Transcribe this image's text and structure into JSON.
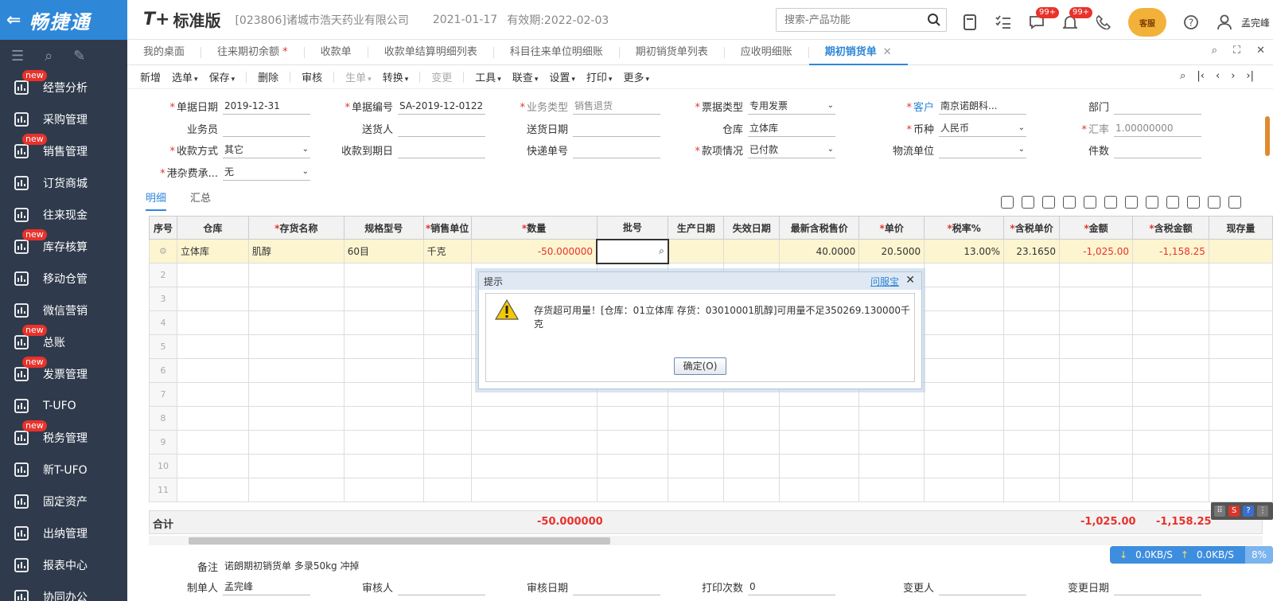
{
  "app": {
    "logo_text": "畅捷通",
    "brand": "T+",
    "brand_sub": "标准版",
    "company": "[023806]诸城市浩天药业有限公司",
    "date": "2021-01-17",
    "expiry": "有效期:2022-02-03",
    "search_placeholder": "搜索-产品功能",
    "badge1": "99+",
    "badge2": "99+",
    "kefu": "客服",
    "username": "孟完峰"
  },
  "sidebar": {
    "items": [
      {
        "label": "经营分析",
        "new": "new"
      },
      {
        "label": "采购管理",
        "new": ""
      },
      {
        "label": "销售管理",
        "new": "new"
      },
      {
        "label": "订货商城",
        "new": ""
      },
      {
        "label": "往来现金",
        "new": ""
      },
      {
        "label": "库存核算",
        "new": "new"
      },
      {
        "label": "移动仓管",
        "new": ""
      },
      {
        "label": "微信营销",
        "new": ""
      },
      {
        "label": "总账",
        "new": "new"
      },
      {
        "label": "发票管理",
        "new": "new"
      },
      {
        "label": "T-UFO",
        "new": ""
      },
      {
        "label": "税务管理",
        "new": "new"
      },
      {
        "label": "新T-UFO",
        "new": ""
      },
      {
        "label": "固定资产",
        "new": ""
      },
      {
        "label": "出纳管理",
        "new": ""
      },
      {
        "label": "报表中心",
        "new": ""
      },
      {
        "label": "协同办公",
        "new": ""
      }
    ]
  },
  "tabs": [
    {
      "label": "我的桌面",
      "star": ""
    },
    {
      "label": "往来期初余额",
      "star": "*"
    },
    {
      "label": "收款单",
      "star": ""
    },
    {
      "label": "收款单结算明细列表",
      "star": ""
    },
    {
      "label": "科目往来单位明细账",
      "star": ""
    },
    {
      "label": "期初销货单列表",
      "star": ""
    },
    {
      "label": "应收明细账",
      "star": ""
    },
    {
      "label": "期初销货单",
      "star": ""
    }
  ],
  "toolbar": {
    "new": "新增",
    "select": "选单",
    "save": "保存",
    "delete": "删除",
    "audit": "审核",
    "gen": "生单",
    "convert": "转换",
    "change": "变更",
    "tools": "工具",
    "query": "联查",
    "settings": "设置",
    "print": "打印",
    "more": "更多"
  },
  "form": {
    "doc_date_label": "单据日期",
    "doc_date": "2019-12-31",
    "doc_no_label": "单据编号",
    "doc_no": "SA-2019-12-0122",
    "biz_type_label": "业务类型",
    "biz_type": "销售退货",
    "invoice_type_label": "票据类型",
    "invoice_type": "专用发票",
    "customer_label": "客户",
    "customer": "南京诺朗科...",
    "dept_label": "部门",
    "dept": "",
    "salesman_label": "业务员",
    "salesman": "",
    "deliverer_label": "送货人",
    "deliverer": "",
    "deliver_date_label": "送货日期",
    "deliver_date": "",
    "warehouse_label": "仓库",
    "warehouse": "立体库",
    "currency_label": "币种",
    "currency": "人民币",
    "rate_label": "汇率",
    "rate": "1.00000000",
    "pay_method_label": "收款方式",
    "pay_method": "其它",
    "due_date_label": "收款到期日",
    "due_date": "",
    "express_label": "快递单号",
    "express": "",
    "pay_status_label": "款项情况",
    "pay_status": "已付款",
    "logistics_label": "物流单位",
    "logistics": "",
    "pieces_label": "件数",
    "pieces": "",
    "port_fee_label": "港杂费承...",
    "port_fee": "无"
  },
  "detail_tabs": {
    "detail": "明细",
    "summary": "汇总"
  },
  "grid": {
    "headers": [
      "序号",
      "仓库",
      "存货名称",
      "规格型号",
      "销售单位",
      "数量",
      "批号",
      "生产日期",
      "失效日期",
      "最新含税售价",
      "单价",
      "税率%",
      "含税单价",
      "金额",
      "含税金额",
      "现存量"
    ],
    "first_row": {
      "warehouse": "立体库",
      "name": "肌醇",
      "spec": "60目",
      "unit": "千克",
      "qty": "-50.000000",
      "latest_price": "40.0000",
      "price": "20.5000",
      "tax_rate": "13.00%",
      "tax_price": "23.1650",
      "amount": "-1,025.00",
      "tax_amount": "-1,158.25"
    },
    "row_numbers": [
      "2",
      "3",
      "4",
      "5",
      "6",
      "7",
      "8",
      "9",
      "10",
      "11"
    ]
  },
  "totals": {
    "label": "合计",
    "qty": "-50.000000",
    "amount": "-1,025.00",
    "tax_amount": "-1,158.25"
  },
  "bottom": {
    "remark_label": "备注",
    "remark": "诺朗期初销货单 多录50kg  冲掉",
    "creator_label": "制单人",
    "creator": "孟完峰",
    "auditor_label": "审核人",
    "auditor": "",
    "audit_date_label": "审核日期",
    "audit_date": "",
    "print_count_label": "打印次数",
    "print_count": "0",
    "changer_label": "变更人",
    "changer": "",
    "change_date_label": "变更日期",
    "change_date": ""
  },
  "modal": {
    "title": "提示",
    "help": "问服宝",
    "message": "存货超可用量！[仓库：01立体库 存货：03010001肌醇]可用量不足350269.130000千克",
    "ok": "确定(O)"
  },
  "net": {
    "down": "0.0KB/S",
    "up": "0.0KB/S",
    "pct": "8%"
  }
}
